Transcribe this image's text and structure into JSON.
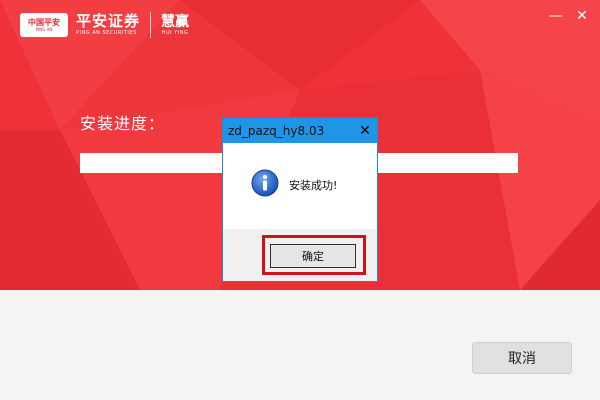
{
  "window": {
    "minimize_glyph": "—",
    "close_glyph": "✕"
  },
  "branding": {
    "logo_main": "中国平安",
    "logo_sub": "PING AN",
    "name_cn": "平安证券",
    "name_en": "PING AN SECURITIES",
    "product_cn": "慧赢",
    "product_en": "HUI YING"
  },
  "installer": {
    "progress_label": "安装进度：",
    "progress": 1.0,
    "cancel_label": "取消"
  },
  "dialog": {
    "title": "zd_pazq_hy8.03",
    "close_glyph": "✕",
    "message": "安装成功!",
    "ok_label": "确定",
    "icon": "info-icon"
  },
  "colors": {
    "hero_red": "#f0333a",
    "dialog_title_blue": "#1e95e6",
    "highlight_red": "#d0111a"
  }
}
